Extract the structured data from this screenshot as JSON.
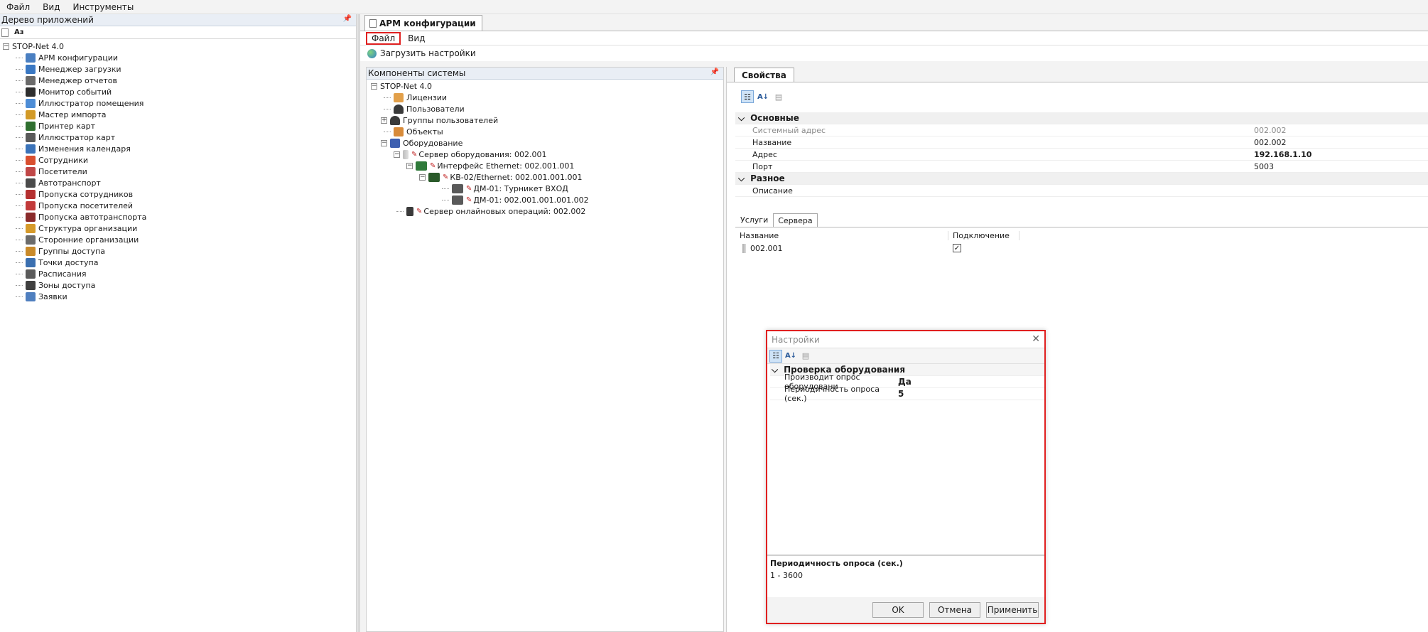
{
  "menubar": {
    "items": [
      "Файл",
      "Вид",
      "Инструменты"
    ]
  },
  "left_pane": {
    "title": "Дерево приложений",
    "toolbar_text": "Аз",
    "root": "STOP-Net 4.0",
    "items": [
      {
        "label": "АРМ конфигурации",
        "icon": "config-icon",
        "color": "#4a7fc1"
      },
      {
        "label": "Менеджер загрузки",
        "icon": "download-icon",
        "color": "#3a78c3"
      },
      {
        "label": "Менеджер отчетов",
        "icon": "report-icon",
        "color": "#6a6a6a"
      },
      {
        "label": "Монитор событий",
        "icon": "eye-icon",
        "color": "#2e2e2e"
      },
      {
        "label": "Иллюстратор помещения",
        "icon": "room-icon",
        "color": "#4d8dd6"
      },
      {
        "label": "Мастер импорта",
        "icon": "import-icon",
        "color": "#d29a27"
      },
      {
        "label": "Принтер карт",
        "icon": "printer-icon",
        "color": "#2f6f2f"
      },
      {
        "label": "Иллюстратор карт",
        "icon": "card-icon",
        "color": "#5a5a5a"
      },
      {
        "label": "Изменения календаря",
        "icon": "calendar-icon",
        "color": "#3b73b9"
      },
      {
        "label": "Сотрудники",
        "icon": "employees-icon",
        "color": "#d94f2f"
      },
      {
        "label": "Посетители",
        "icon": "visitors-icon",
        "color": "#c04747"
      },
      {
        "label": "Автотранспорт",
        "icon": "car-icon",
        "color": "#4a4a4a"
      },
      {
        "label": "Пропуска сотрудников",
        "icon": "employee-pass-icon",
        "color": "#b53030"
      },
      {
        "label": "Пропуска посетителей",
        "icon": "visitor-pass-icon",
        "color": "#c23a3a"
      },
      {
        "label": "Пропуска автотранспорта",
        "icon": "car-pass-icon",
        "color": "#8a2a2a"
      },
      {
        "label": "Структура организации",
        "icon": "org-structure-icon",
        "color": "#d69a2a"
      },
      {
        "label": "Сторонние организации",
        "icon": "building-icon",
        "color": "#6b6b6b"
      },
      {
        "label": "Группы доступа",
        "icon": "access-groups-icon",
        "color": "#c98a2a"
      },
      {
        "label": "Точки доступа",
        "icon": "access-point-icon",
        "color": "#3a6fb0"
      },
      {
        "label": "Расписания",
        "icon": "schedule-icon",
        "color": "#5a5a5a"
      },
      {
        "label": "Зоны доступа",
        "icon": "zones-icon",
        "color": "#3f3f3f"
      },
      {
        "label": "Заявки",
        "icon": "requests-icon",
        "color": "#4f7fbf"
      }
    ]
  },
  "doc_tab": {
    "label": "АРМ конфигурации"
  },
  "sub_menu": {
    "file": "Файл",
    "view": "Вид"
  },
  "load_settings": "Загрузить настройки",
  "components": {
    "title": "Компоненты системы",
    "root": "STOP-Net 4.0",
    "licenses": "Лицензии",
    "users": "Пользователи",
    "user_groups": "Группы пользователей",
    "objects": "Объекты",
    "equipment": "Оборудование",
    "equipment_server": "Сервер оборудования: 002.001",
    "ethernet_interface": "Интерфейс Ethernet: 002.001.001",
    "kv02": "КВ-02/Ethernet: 002.001.001.001",
    "dm01_entry": "ДМ-01: Турникет ВХОД",
    "dm01_2": "ДМ-01: 002.001.001.001.002",
    "online_server": "Сервер онлайновых операций: 002.002"
  },
  "properties": {
    "tab": "Свойства",
    "cat_main": "Основные",
    "rows": [
      {
        "label": "Системный адрес",
        "value": "002.002"
      },
      {
        "label": "Название",
        "value": "002.002"
      },
      {
        "label": "Адрес",
        "value": "192.168.1.10"
      },
      {
        "label": "Порт",
        "value": "5003"
      }
    ],
    "cat_misc": "Разное",
    "description_label": "Описание"
  },
  "subtabs": {
    "services": "Услуги",
    "servers": "Сервера"
  },
  "servers_table": {
    "col_name": "Название",
    "col_connection": "Подключение",
    "rows": [
      {
        "name": "002.001",
        "connected": true
      }
    ],
    "check_glyph": "✓"
  },
  "dialog": {
    "title": "Настройки",
    "category": "Проверка оборудования",
    "rows": [
      {
        "label": "Производит опрос оборудовани",
        "value": "Да"
      },
      {
        "label": "Периодичность опроса (сек.)",
        "value": "5"
      }
    ],
    "desc_title": "Периодичность опроса (сек.)",
    "desc_text": "1 - 3600",
    "ok": "OK",
    "cancel": "Отмена",
    "apply": "Применить"
  },
  "colors": {
    "highlight_red": "#e02020",
    "header_blue": "#e9eef5"
  }
}
